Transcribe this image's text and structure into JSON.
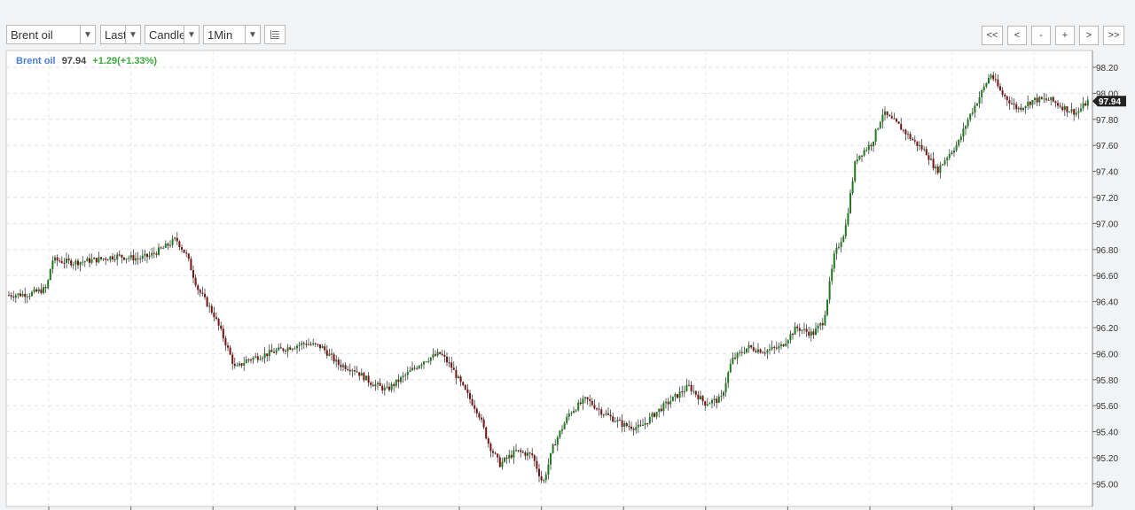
{
  "toolbar": {
    "symbol": "Brent oil",
    "price_type": "Last",
    "chart_type": "Candle",
    "interval": "1Min",
    "nav": [
      "<<",
      "<",
      "-",
      "+",
      ">",
      ">>"
    ]
  },
  "legend": {
    "symbol": "Brent oil",
    "price": "97.94",
    "change": "+1.29(+1.33%)"
  },
  "colors": {
    "up": "#1f7a1f",
    "down": "#7a1010",
    "legend_symbol": "#4a7fd4",
    "legend_change": "#3aaa3a"
  },
  "chart_data": {
    "type": "candlestick",
    "title": "Brent oil",
    "last_price_label": "97.94",
    "ylim": [
      94.88,
      98.22
    ],
    "yticks": [
      "98.20",
      "98.00",
      "97.80",
      "97.60",
      "97.40",
      "97.20",
      "97.00",
      "96.80",
      "96.60",
      "96.40",
      "96.20",
      "96.00",
      "95.80",
      "95.60",
      "95.40",
      "95.20",
      "95.00"
    ],
    "grid": true,
    "close_path": [
      [
        0,
        96.45
      ],
      [
        0.02,
        96.46
      ],
      [
        0.035,
        96.5
      ],
      [
        0.04,
        96.72
      ],
      [
        0.06,
        96.7
      ],
      [
        0.08,
        96.72
      ],
      [
        0.1,
        96.75
      ],
      [
        0.12,
        96.73
      ],
      [
        0.13,
        96.75
      ],
      [
        0.145,
        96.82
      ],
      [
        0.155,
        96.88
      ],
      [
        0.165,
        96.75
      ],
      [
        0.175,
        96.5
      ],
      [
        0.19,
        96.3
      ],
      [
        0.2,
        96.1
      ],
      [
        0.21,
        95.88
      ],
      [
        0.22,
        95.95
      ],
      [
        0.24,
        96.0
      ],
      [
        0.26,
        96.05
      ],
      [
        0.275,
        96.08
      ],
      [
        0.29,
        96.05
      ],
      [
        0.305,
        95.92
      ],
      [
        0.32,
        95.88
      ],
      [
        0.335,
        95.78
      ],
      [
        0.35,
        95.72
      ],
      [
        0.37,
        95.85
      ],
      [
        0.385,
        95.95
      ],
      [
        0.4,
        96.0
      ],
      [
        0.41,
        95.9
      ],
      [
        0.42,
        95.75
      ],
      [
        0.435,
        95.55
      ],
      [
        0.445,
        95.3
      ],
      [
        0.455,
        95.15
      ],
      [
        0.47,
        95.25
      ],
      [
        0.485,
        95.22
      ],
      [
        0.495,
        95.0
      ],
      [
        0.505,
        95.3
      ],
      [
        0.52,
        95.55
      ],
      [
        0.535,
        95.65
      ],
      [
        0.55,
        95.55
      ],
      [
        0.57,
        95.45
      ],
      [
        0.585,
        95.43
      ],
      [
        0.6,
        95.55
      ],
      [
        0.615,
        95.65
      ],
      [
        0.63,
        95.75
      ],
      [
        0.645,
        95.62
      ],
      [
        0.66,
        95.65
      ],
      [
        0.67,
        95.95
      ],
      [
        0.685,
        96.05
      ],
      [
        0.7,
        96.02
      ],
      [
        0.715,
        96.05
      ],
      [
        0.73,
        96.2
      ],
      [
        0.745,
        96.15
      ],
      [
        0.755,
        96.25
      ],
      [
        0.765,
        96.75
      ],
      [
        0.775,
        96.95
      ],
      [
        0.785,
        97.5
      ],
      [
        0.8,
        97.62
      ],
      [
        0.81,
        97.85
      ],
      [
        0.825,
        97.75
      ],
      [
        0.84,
        97.62
      ],
      [
        0.85,
        97.55
      ],
      [
        0.86,
        97.4
      ],
      [
        0.87,
        97.52
      ],
      [
        0.88,
        97.62
      ],
      [
        0.89,
        97.82
      ],
      [
        0.9,
        97.98
      ],
      [
        0.91,
        98.15
      ],
      [
        0.92,
        98.0
      ],
      [
        0.935,
        97.88
      ],
      [
        0.95,
        97.95
      ],
      [
        0.965,
        97.95
      ],
      [
        0.98,
        97.88
      ],
      [
        0.99,
        97.85
      ],
      [
        1.0,
        97.94
      ]
    ]
  }
}
